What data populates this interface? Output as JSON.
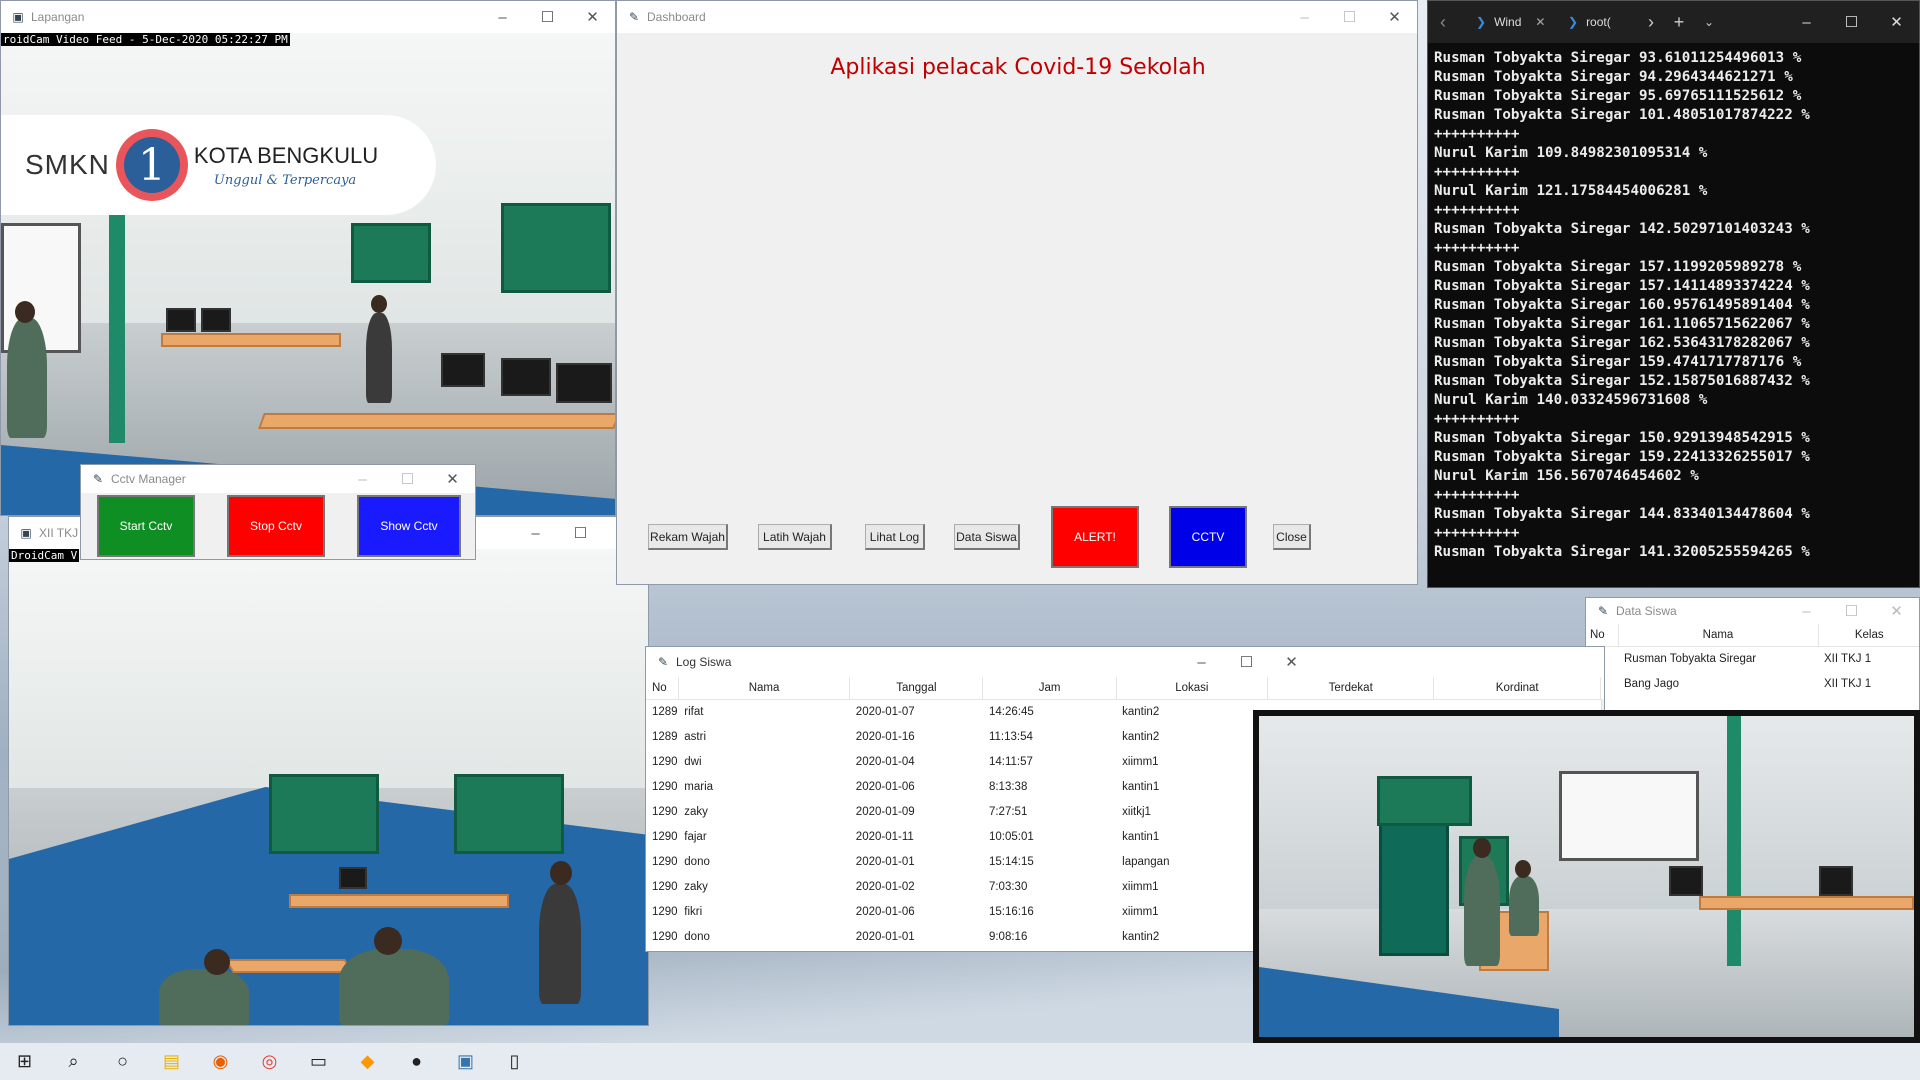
{
  "desktop": {
    "wallpaper": "snowy-mountain"
  },
  "lapangan_window": {
    "title": "Lapangan",
    "overlay": "roidCam Video Feed -  5-Dec-2020 05:22:27 PM",
    "logo": {
      "smkn": "SMKN",
      "one": "1",
      "city": "KOTA BENGKULU",
      "tagline": "Unggul & Terpercaya"
    }
  },
  "xii_window": {
    "title": "XII TKJ 1",
    "overlay": "DroidCam V"
  },
  "cctv_manager": {
    "title": "Cctv Manager",
    "buttons": [
      {
        "label": "Start Cctv",
        "color": "#0f8f23"
      },
      {
        "label": "Stop Cctv",
        "color": "#ff0000"
      },
      {
        "label": "Show Cctv",
        "color": "#1a1aff"
      }
    ]
  },
  "dashboard": {
    "title": "Dashboard",
    "heading": "Aplikasi pelacak Covid-19 Sekolah",
    "heading_color": "#c00000",
    "buttons": {
      "rekam": "Rekam Wajah",
      "latih": "Latih Wajah",
      "log": "Lihat Log",
      "siswa": "Data Siswa",
      "alert": "ALERT!",
      "cctv": "CCTV",
      "close": "Close"
    }
  },
  "terminal": {
    "tabs": [
      {
        "label": "Wind"
      },
      {
        "label": "root("
      }
    ],
    "lines": [
      "Rusman Tobyakta Siregar 93.61011254496013 %",
      "Rusman Tobyakta Siregar 94.2964344621271 %",
      "Rusman Tobyakta Siregar 95.69765111525612 %",
      "Rusman Tobyakta Siregar 101.48051017874222 %",
      "++++++++++",
      "Nurul Karim 109.84982301095314 %",
      "++++++++++",
      "Nurul Karim 121.17584454006281 %",
      "++++++++++",
      "Rusman Tobyakta Siregar 142.50297101403243 %",
      "++++++++++",
      "Rusman Tobyakta Siregar 157.1199205989278 %",
      "Rusman Tobyakta Siregar 157.14114893374224 %",
      "Rusman Tobyakta Siregar 160.95761495891404 %",
      "Rusman Tobyakta Siregar 161.11065715622067 %",
      "Rusman Tobyakta Siregar 162.53643178282067 %",
      "Rusman Tobyakta Siregar 159.4741717787176 %",
      "Rusman Tobyakta Siregar 152.15875016887432 %",
      "Nurul Karim 140.03324596731608 %",
      "++++++++++",
      "Rusman Tobyakta Siregar 150.92913948542915 %",
      "Rusman Tobyakta Siregar 159.22413326255017 %",
      "Nurul Karim 156.5670746454602 %",
      "++++++++++",
      "Rusman Tobyakta Siregar 144.83340134478604 %",
      "++++++++++",
      "Rusman Tobyakta Siregar 141.32005255594265 %"
    ]
  },
  "data_siswa": {
    "title": "Data Siswa",
    "columns": [
      "No",
      "Nama",
      "Kelas"
    ],
    "rows": [
      {
        "no": "",
        "nama": "Rusman Tobyakta Siregar",
        "kelas": "XII TKJ 1"
      },
      {
        "no": "",
        "nama": "Bang Jago",
        "kelas": "XII TKJ 1"
      }
    ]
  },
  "log_siswa": {
    "title": "Log Siswa",
    "columns": [
      "No",
      "Nama",
      "Tanggal",
      "Jam",
      "Lokasi",
      "Terdekat",
      "Kordinat"
    ],
    "rows": [
      {
        "no": "1289",
        "nama": "rifat",
        "tanggal": "2020-01-07",
        "jam": "14:26:45",
        "lokasi": "kantin2"
      },
      {
        "no": "1289",
        "nama": "astri",
        "tanggal": "2020-01-16",
        "jam": "11:13:54",
        "lokasi": "kantin2"
      },
      {
        "no": "1290",
        "nama": "dwi",
        "tanggal": "2020-01-04",
        "jam": "14:11:57",
        "lokasi": "xiimm1"
      },
      {
        "no": "1290",
        "nama": "maria",
        "tanggal": "2020-01-06",
        "jam": "8:13:38",
        "lokasi": "kantin1"
      },
      {
        "no": "1290",
        "nama": "zaky",
        "tanggal": "2020-01-09",
        "jam": "7:27:51",
        "lokasi": "xiitkj1"
      },
      {
        "no": "1290",
        "nama": "fajar",
        "tanggal": "2020-01-11",
        "jam": "10:05:01",
        "lokasi": "kantin1"
      },
      {
        "no": "1290",
        "nama": "dono",
        "tanggal": "2020-01-01",
        "jam": "15:14:15",
        "lokasi": "lapangan"
      },
      {
        "no": "1290",
        "nama": "zaky",
        "tanggal": "2020-01-02",
        "jam": "7:03:30",
        "lokasi": "xiimm1"
      },
      {
        "no": "1290",
        "nama": "fikri",
        "tanggal": "2020-01-06",
        "jam": "15:16:16",
        "lokasi": "xiimm1"
      },
      {
        "no": "1290",
        "nama": "dono",
        "tanggal": "2020-01-01",
        "jam": "9:08:16",
        "lokasi": "kantin2"
      }
    ]
  },
  "taskbar": {
    "icons": [
      "windows-icon",
      "search-icon",
      "cortana-icon",
      "file-explorer-icon",
      "firefox-icon",
      "chrome-icon",
      "terminal-icon",
      "sublime-icon",
      "app-icon",
      "python-icon",
      "notepad-icon"
    ]
  }
}
